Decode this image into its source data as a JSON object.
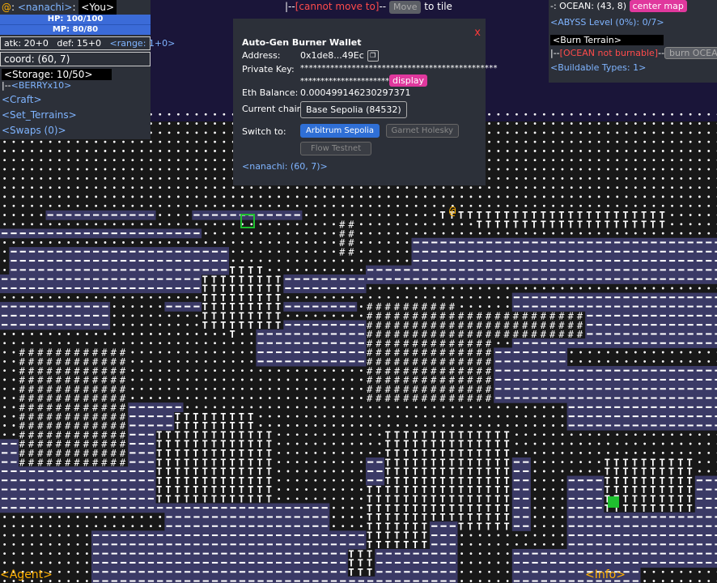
{
  "player": {
    "symbol": "@",
    "name_tag": "<nanachi>",
    "you_tag": "<You>",
    "hp": "HP: 100/100",
    "mp": "MP: 80/80",
    "hp_fraction": 1.0,
    "mp_fraction": 1.0,
    "atk": "atk: 20+0",
    "def": "def: 15+0",
    "range": "<range: 1+0>",
    "coord": "coord: (60, 7)",
    "storage": "<Storage: 10/50>",
    "item": "<BERRYx10>",
    "item_prefix": "|--",
    "craft": "<Craft>",
    "set_terrains": "<Set_Terrains>",
    "swaps": "<Swaps (0)>"
  },
  "top_bar": {
    "prefix": "|--",
    "status": "[cannot move to]",
    "sep": "--",
    "move_button": "Move",
    "suffix": "to tile"
  },
  "wallet": {
    "close": "x",
    "title": "Auto-Gen Burner Wallet",
    "address_label": "Address:",
    "address": "0x1de8...49Ec",
    "private_key_label": "Private Key:",
    "private_key_line1": "**********************************************",
    "private_key_line2": "**********************",
    "display_button": "display",
    "balance_label": "Eth Balance:",
    "balance": "0.000499146230297371",
    "chain_label": "Current chain:",
    "chain": "Base Sepolia (84532)",
    "switch_label": "Switch to:",
    "switch_options": [
      "Arbitrum Sepolia",
      "Garnet Holesky",
      "Flow Testnet"
    ],
    "footer": "<nanachi: (60, 7)>"
  },
  "tile_info": {
    "ocean": "-: OCEAN: (43, 8)",
    "center_map": "center map",
    "abyss": "<ABYSS Level (0%): 0/7>",
    "burn_terrain": "<Burn Terrain>",
    "burn_prefix": "|--",
    "burn_status": "[OCEAN not burnable]",
    "burn_sep": "--",
    "burn_button": "burn OCEAN",
    "buildable": "<Buildable Types: 1>"
  },
  "footer": {
    "agent": "<Agent>",
    "info": "<Info>"
  },
  "colors": {
    "panel_bg": "#2c3039",
    "night_sky": "#1a1539",
    "ocean": "#3b3a66",
    "land": "#1a1a1a",
    "accent_pink": "#e0389d",
    "link_blue": "#7fb4ff",
    "warning_red": "#ff4b4b",
    "player_orange": "#ffb000",
    "cursor_green": "#1fbf2f"
  },
  "map_legend": {
    "ocean_glyph": "-",
    "land_glyph": ".",
    "tree_glyph": "T",
    "rock_glyph": "#"
  }
}
